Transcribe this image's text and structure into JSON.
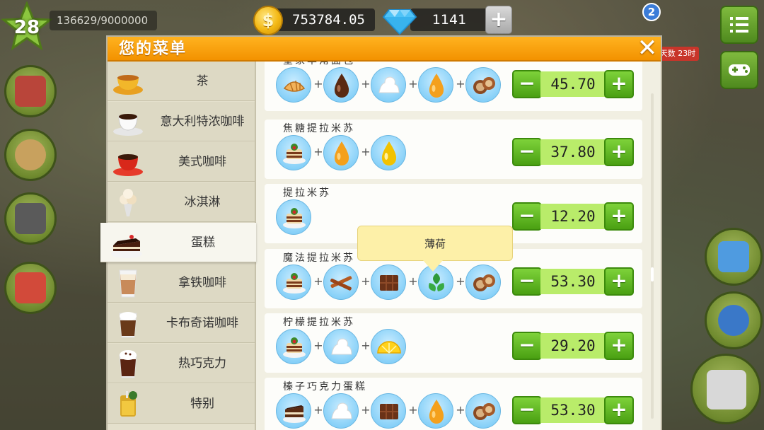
{
  "hud": {
    "level": "28",
    "xp_text": "136629/9000000",
    "coins": "753784.05",
    "gems": "1141",
    "gem_plus": "+",
    "notif_badge": "2",
    "timer_text": "天数 23时"
  },
  "panel": {
    "title": "您的菜单",
    "close_label": "✕"
  },
  "categories": [
    {
      "label": "茶",
      "icon": "tea-cup-icon"
    },
    {
      "label": "意大利特浓咖啡",
      "icon": "espresso-cup-icon"
    },
    {
      "label": "美式咖啡",
      "icon": "americano-cup-icon"
    },
    {
      "label": "冰淇淋",
      "icon": "ice-cream-icon"
    },
    {
      "label": "蛋糕",
      "icon": "cake-icon",
      "active": true
    },
    {
      "label": "拿铁咖啡",
      "icon": "latte-glass-icon"
    },
    {
      "label": "卡布奇诺咖啡",
      "icon": "cappuccino-glass-icon"
    },
    {
      "label": "热巧克力",
      "icon": "hot-chocolate-icon"
    },
    {
      "label": "特别",
      "icon": "special-drink-icon"
    }
  ],
  "recipes": [
    {
      "name": "皇家羊角面包",
      "ingredients": [
        "croissant",
        "chocolate-drop",
        "cream",
        "caramel-drop",
        "hazelnut"
      ],
      "price": "45.70"
    },
    {
      "name": "焦糖提拉米苏",
      "ingredients": [
        "tiramisu",
        "caramel-drop",
        "syrup-drop"
      ],
      "price": "37.80"
    },
    {
      "name": "提拉米苏",
      "ingredients": [
        "tiramisu"
      ],
      "price": "12.20"
    },
    {
      "name": "魔法提拉米苏",
      "ingredients": [
        "tiramisu",
        "cinnamon",
        "chocolate-bar",
        "mint",
        "hazelnut"
      ],
      "price": "53.30"
    },
    {
      "name": "柠檬提拉米苏",
      "ingredients": [
        "tiramisu",
        "cream",
        "lemon"
      ],
      "price": "29.20"
    },
    {
      "name": "榛子巧克力蛋糕",
      "ingredients": [
        "chocolate-cake",
        "cream",
        "chocolate-bar",
        "caramel-drop",
        "hazelnut"
      ],
      "price": "53.30"
    }
  ],
  "tooltip": {
    "text": "薄荷"
  },
  "controls": {
    "minus": "−",
    "plus": "+",
    "join": "+"
  }
}
